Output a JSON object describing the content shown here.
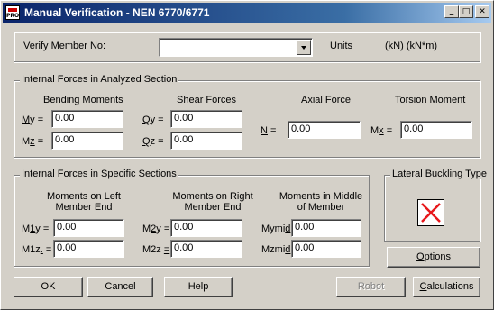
{
  "window": {
    "title": "Manual Verification - NEN 6770/6771",
    "app_icon": "PRO",
    "controls": {
      "minimize": "_",
      "maximize": "□",
      "close": "✕"
    }
  },
  "verify": {
    "label_pre": "",
    "label_key": "V",
    "label_post": "erify Member No:",
    "value": "",
    "units_label": "Units",
    "units_value": "(kN) (kN*m)"
  },
  "analyzed": {
    "legend": "Internal Forces in Analyzed Section",
    "bending_header": "Bending Moments",
    "shear_header": "Shear Forces",
    "axial_header": "Axial Force",
    "torsion_header": "Torsion Moment",
    "my": {
      "pre": "",
      "key": "M",
      "post": "y =",
      "value": "0.00"
    },
    "mz": {
      "pre": "M",
      "key": "z",
      "post": " =",
      "value": "0.00"
    },
    "qy": {
      "pre": "",
      "key": "Q",
      "post": "y =",
      "value": "0.00"
    },
    "qz": {
      "pre": "",
      "key": "Q",
      "post": "z =",
      "value": "0.00"
    },
    "n": {
      "pre": "",
      "key": "N",
      "post": " =",
      "value": "0.00"
    },
    "mx": {
      "pre": "M",
      "key": "x",
      "post": " =",
      "value": "0.00"
    }
  },
  "specific": {
    "legend": "Internal Forces in Specific Sections",
    "left_header_1": "Moments on Left",
    "left_header_2": "Member End",
    "right_header_1": "Moments on Right",
    "right_header_2": "Member End",
    "middle_header_1": "Moments in Middle",
    "middle_header_2": "of Member",
    "m1y": {
      "pre": "M",
      "key": "1",
      "post": "y =",
      "value": "0.00"
    },
    "m1z": {
      "pre": "M1z",
      "key": ".",
      "post": " =",
      "value": "0.00"
    },
    "m2y": {
      "pre": "M",
      "key": "2",
      "post": "y =",
      "value": "0.00"
    },
    "m2z": {
      "pre": "M2z ",
      "key": "=",
      "post": "",
      "value": "0.00"
    },
    "mymid": {
      "pre": "Mymi",
      "key": "d",
      "post": " =",
      "value": "0.00"
    },
    "mzmid": {
      "pre": "Mzmi",
      "key": "d",
      "post": " =",
      "value": "0.00"
    }
  },
  "lateral": {
    "legend": "Lateral Buckling Type",
    "options_pre": "",
    "options_key": "O",
    "options_post": "ptions",
    "x_color": "#e8171b"
  },
  "buttons": {
    "ok": "OK",
    "cancel": "Cancel",
    "help": "Help",
    "robot": "Robot",
    "calc_pre": "",
    "calc_key": "C",
    "calc_post": "alculations"
  }
}
